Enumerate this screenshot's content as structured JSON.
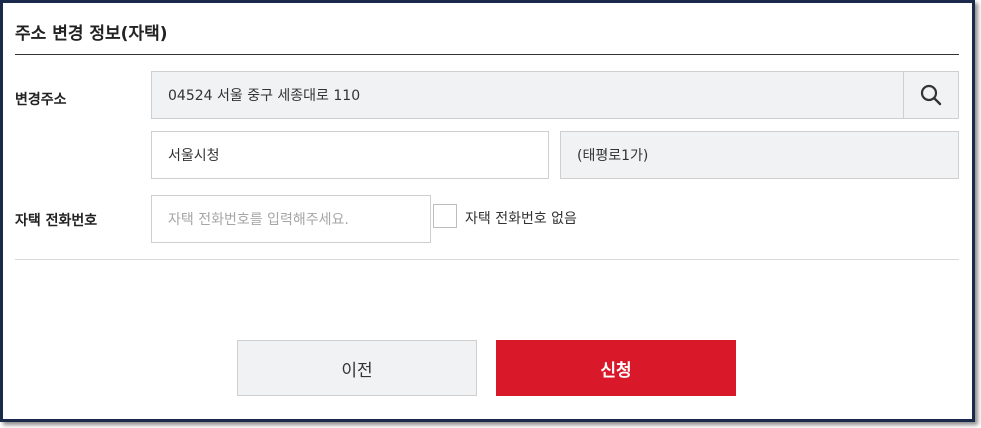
{
  "dialog": {
    "title": "주소 변경 정보(자택)"
  },
  "address": {
    "label": "변경주소",
    "main_value": "04524 서울 중구 세종대로 110",
    "search_icon": "search-icon",
    "detail_value": "서울시청",
    "extra_value": "(태평로1가)"
  },
  "phone": {
    "label": "자택 전화번호",
    "placeholder": "자택 전화번호를 입력해주세요.",
    "no_phone_label": "자택 전화번호 없음",
    "no_phone_checked": false
  },
  "buttons": {
    "prev_label": "이전",
    "submit_label": "신청"
  },
  "colors": {
    "accent": "#d9182a",
    "frame": "#1b2a4a",
    "field_gray": "#f1f2f4"
  }
}
